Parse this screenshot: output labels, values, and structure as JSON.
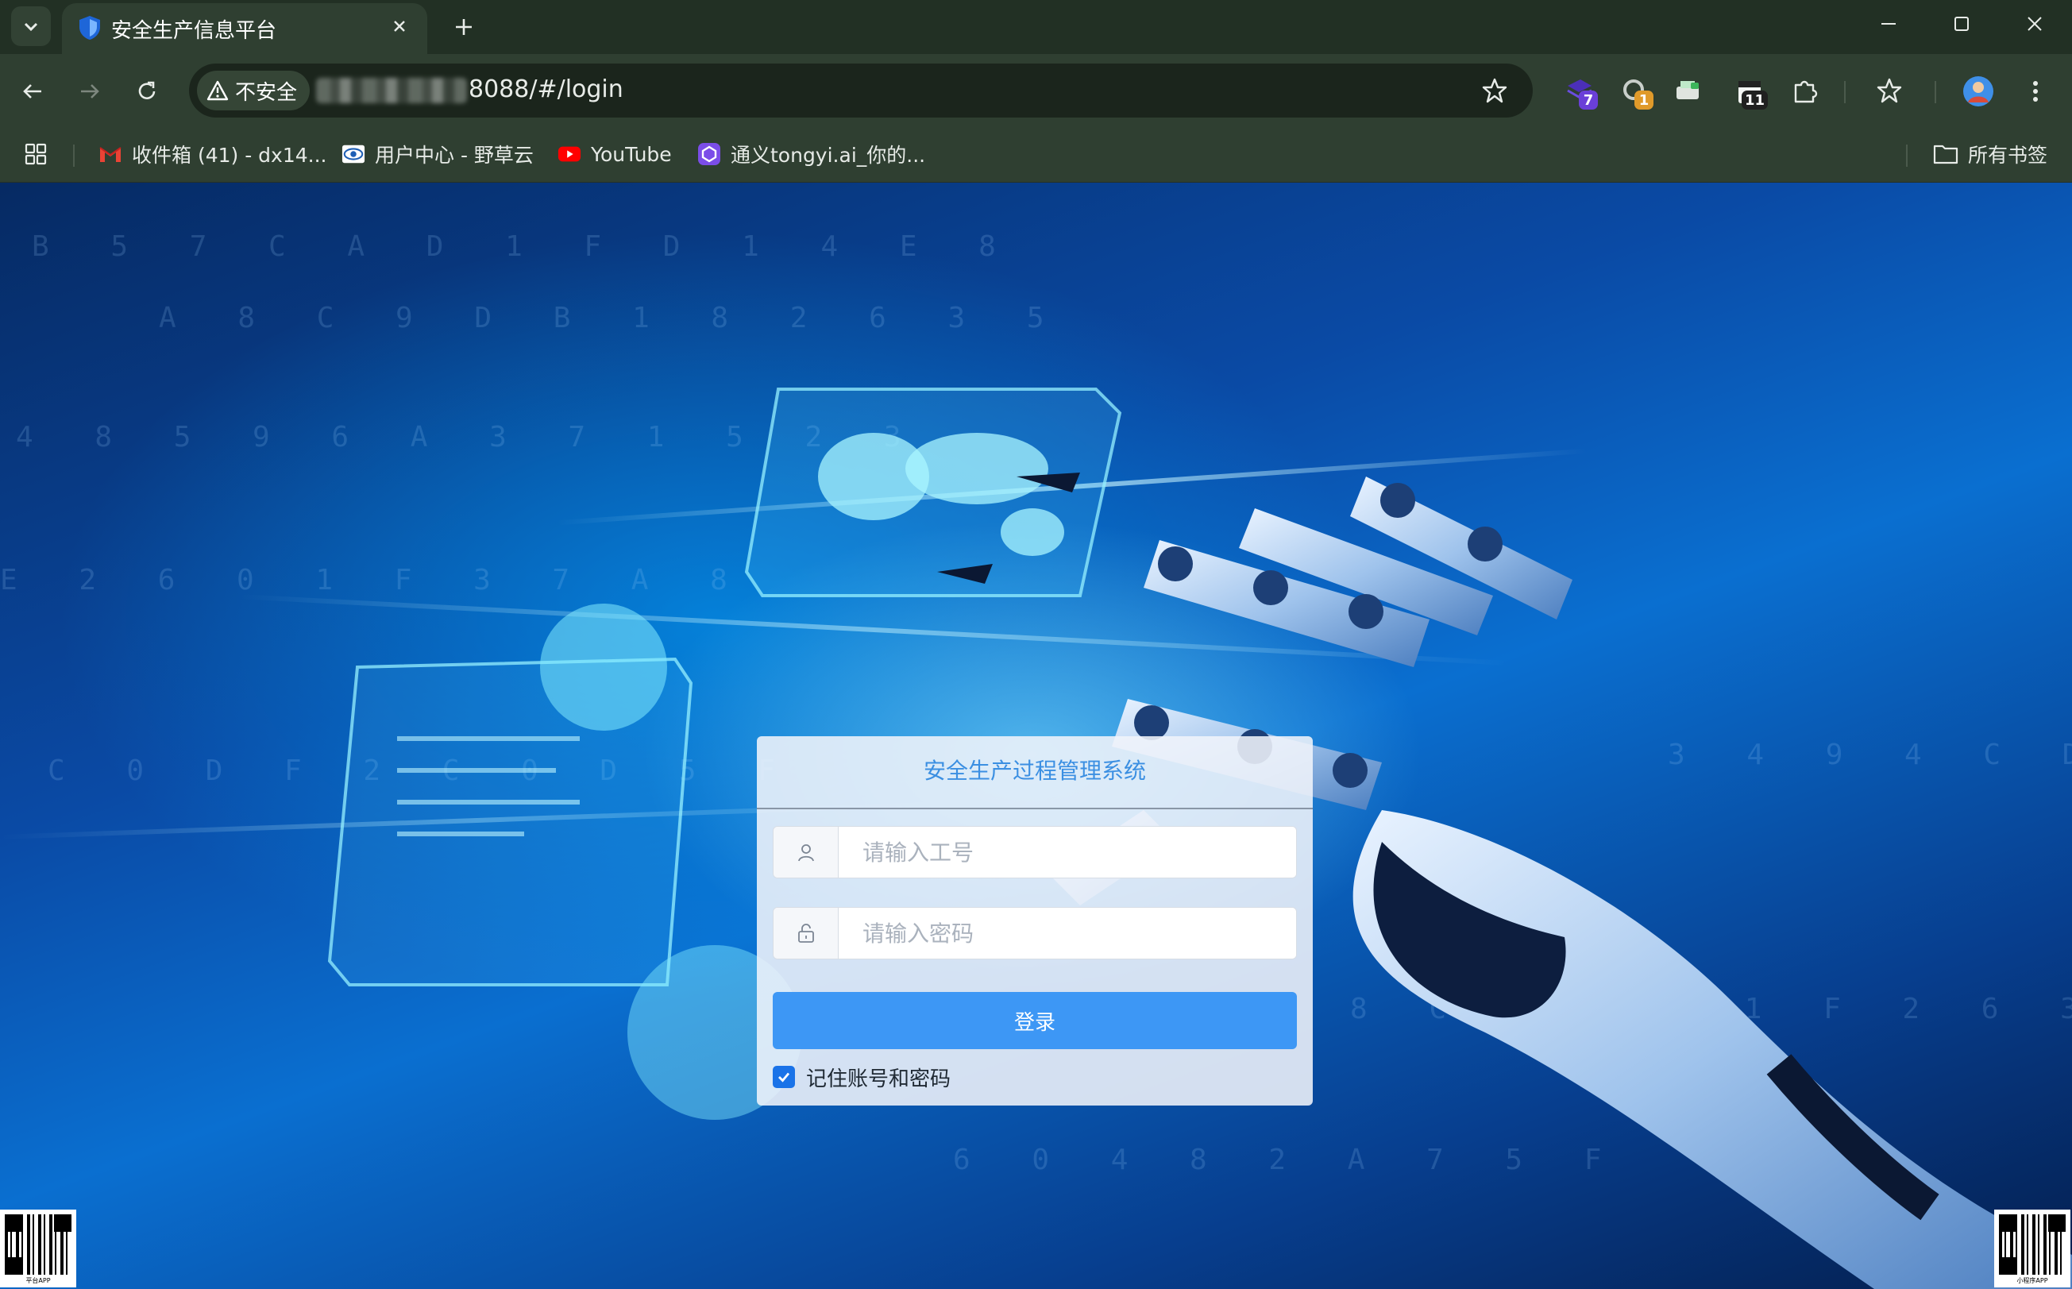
{
  "browser": {
    "tab_title": "安全生产信息平台",
    "security_label": "不安全",
    "url_visible": "8088/#/login",
    "extensions": [
      {
        "name": "bookmark-stack-icon",
        "badge": "7",
        "badge_color": "#6a3fd8"
      },
      {
        "name": "refresh-extension-icon",
        "badge": "1",
        "badge_color": "#e09a2a"
      },
      {
        "name": "print-icon",
        "badge": "",
        "badge_color": ""
      },
      {
        "name": "calendar-icon",
        "badge": "11",
        "badge_color": "#202020"
      },
      {
        "name": "puzzle-icon",
        "badge": "",
        "badge_color": ""
      }
    ],
    "bookmarks": [
      {
        "label": "收件箱 (41) - dx14...",
        "icon": "gmail-icon"
      },
      {
        "label": "用户中心 - 野草云",
        "icon": "eye-cloud-icon"
      },
      {
        "label": "YouTube",
        "icon": "youtube-icon"
      },
      {
        "label": "通义tongyi.ai_你的...",
        "icon": "tongyi-icon"
      }
    ],
    "all_bookmarks_label": "所有书签"
  },
  "login": {
    "title": "安全生产过程管理系统",
    "username_placeholder": "请输入工号",
    "password_placeholder": "请输入密码",
    "submit_label": "登录",
    "remember_label": "记住账号和密码",
    "remember_checked": true
  },
  "qr": {
    "left_caption": "平台APP",
    "right_caption": "小程序APP"
  },
  "colors": {
    "accent": "#3d97f5",
    "title": "#3b8fe2",
    "chrome": "#2f3f31"
  }
}
